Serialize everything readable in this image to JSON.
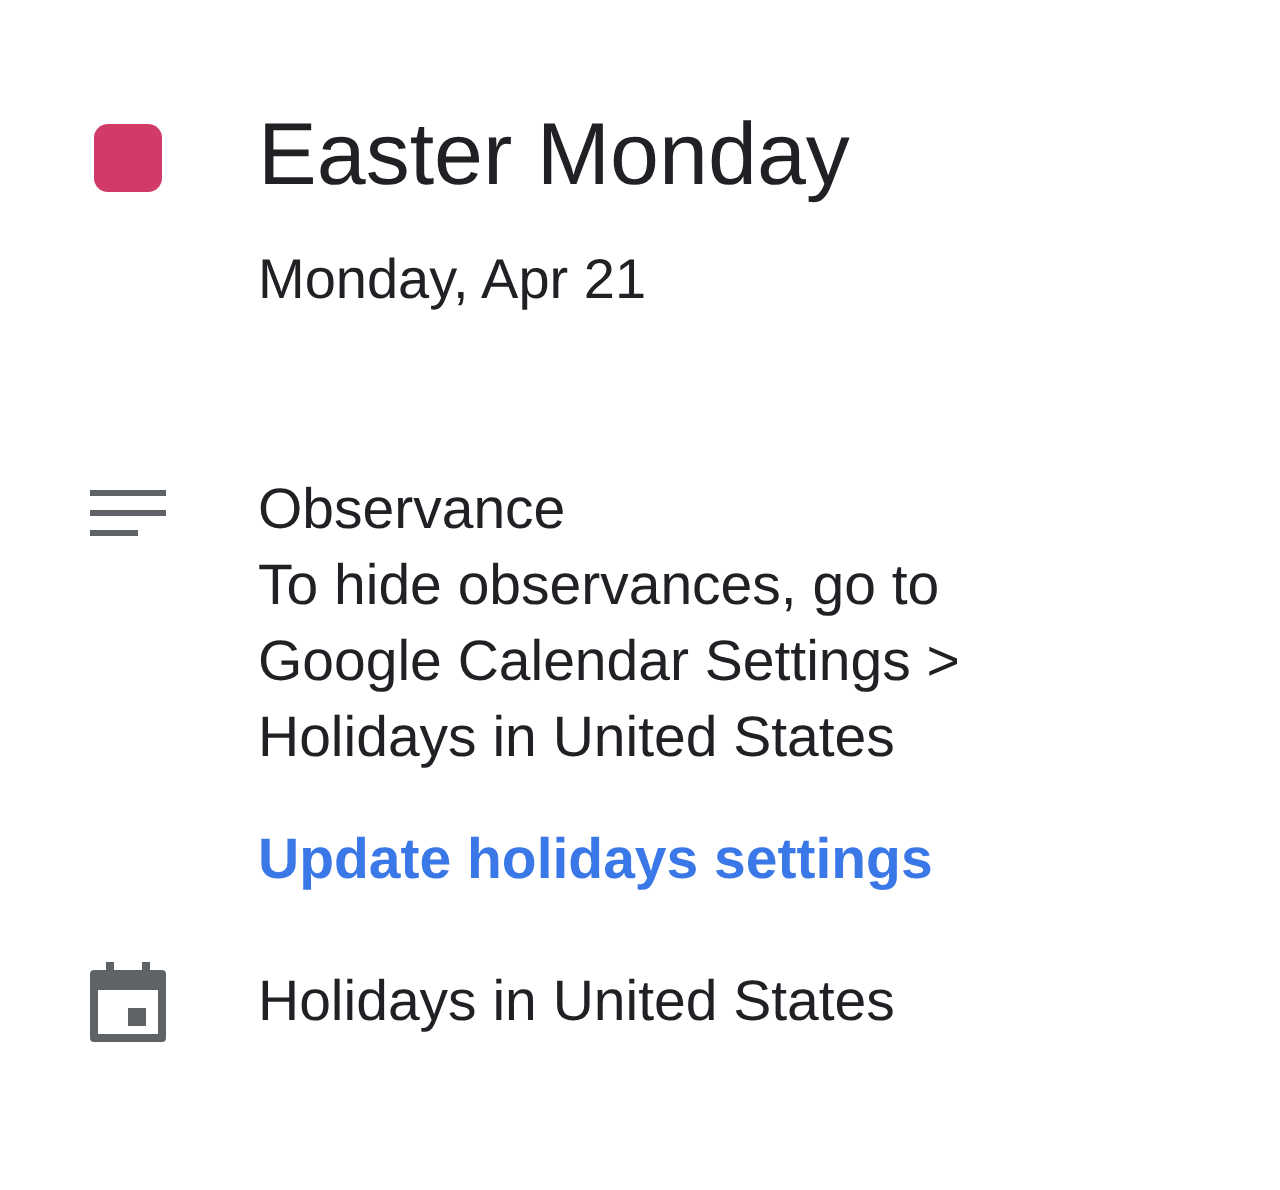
{
  "event": {
    "title": "Easter Monday",
    "color": "#d23a68",
    "date": "Monday, Apr 21"
  },
  "description": {
    "heading": "Observance",
    "text": "To hide observances, go to\nGoogle Calendar Settings >\nHolidays in United States",
    "link": "Update holidays settings"
  },
  "calendar": {
    "name": "Holidays in United States"
  }
}
